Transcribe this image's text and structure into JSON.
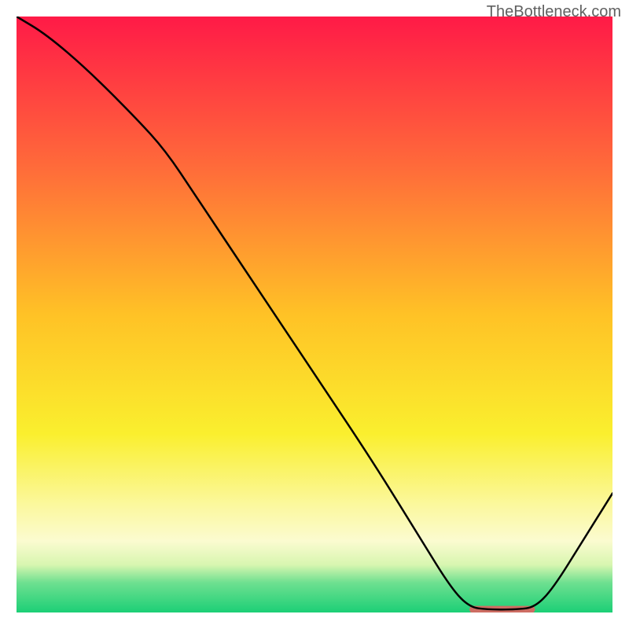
{
  "watermark": "TheBottleneck.com",
  "chart_data": {
    "type": "line",
    "title": "",
    "xlabel": "",
    "ylabel": "",
    "xlim": [
      0,
      100
    ],
    "ylim": [
      0,
      100
    ],
    "background_gradient": {
      "stops": [
        {
          "offset": 0,
          "color": "#ff1a47"
        },
        {
          "offset": 25,
          "color": "#ff6a3a"
        },
        {
          "offset": 50,
          "color": "#ffc226"
        },
        {
          "offset": 70,
          "color": "#faef2e"
        },
        {
          "offset": 82,
          "color": "#fbf89e"
        },
        {
          "offset": 88,
          "color": "#fbfbd0"
        },
        {
          "offset": 92,
          "color": "#d8f6b0"
        },
        {
          "offset": 95,
          "color": "#6ee090"
        },
        {
          "offset": 100,
          "color": "#1ccf76"
        }
      ]
    },
    "series": [
      {
        "name": "bottleneck-curve",
        "color": "#000000",
        "points": [
          {
            "x": 0,
            "y": 100
          },
          {
            "x": 5,
            "y": 97
          },
          {
            "x": 12,
            "y": 91
          },
          {
            "x": 20,
            "y": 83
          },
          {
            "x": 25,
            "y": 77.5
          },
          {
            "x": 30,
            "y": 70
          },
          {
            "x": 40,
            "y": 55
          },
          {
            "x": 50,
            "y": 40
          },
          {
            "x": 60,
            "y": 25
          },
          {
            "x": 68,
            "y": 12
          },
          {
            "x": 73,
            "y": 4
          },
          {
            "x": 76,
            "y": 0.9
          },
          {
            "x": 79,
            "y": 0.5
          },
          {
            "x": 84,
            "y": 0.5
          },
          {
            "x": 87,
            "y": 0.9
          },
          {
            "x": 90,
            "y": 4
          },
          {
            "x": 95,
            "y": 12
          },
          {
            "x": 100,
            "y": 20
          }
        ]
      }
    ],
    "markers": [
      {
        "name": "optimal-segment",
        "type": "bar",
        "color": "#cd6d63",
        "x_start": 76,
        "x_end": 87,
        "y": 0.5,
        "thickness_pct": 1.2
      }
    ]
  }
}
